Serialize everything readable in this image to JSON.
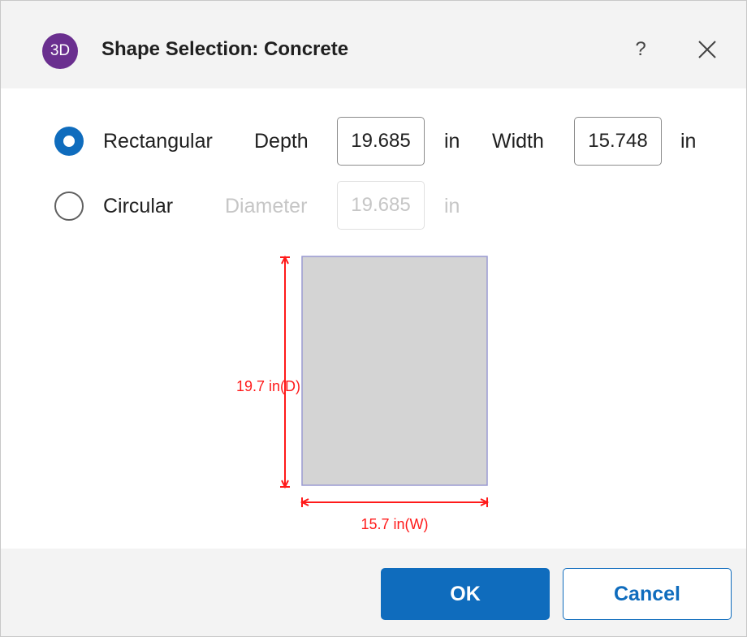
{
  "window": {
    "app_icon_text": "3D",
    "title": "Shape Selection: Concrete",
    "help_label": "?"
  },
  "shape_options": {
    "rectangular": {
      "label": "Rectangular",
      "selected": true,
      "depth_label": "Depth",
      "depth_value": "19.685",
      "depth_unit": "in",
      "width_label": "Width",
      "width_value": "15.748",
      "width_unit": "in"
    },
    "circular": {
      "label": "Circular",
      "selected": false,
      "diameter_label": "Diameter",
      "diameter_value": "19.685",
      "diameter_unit": "in"
    }
  },
  "preview": {
    "depth_dimension": "19.7 in(D)",
    "width_dimension": "15.7 in(W)",
    "fill_color": "#d4d4d4",
    "outline_color": "#9a9ad2",
    "dimension_color": "#ff1a1a"
  },
  "footer": {
    "ok_label": "OK",
    "cancel_label": "Cancel"
  },
  "colors": {
    "accent": "#0f6cbd",
    "app_icon": "#6a2f8f"
  }
}
